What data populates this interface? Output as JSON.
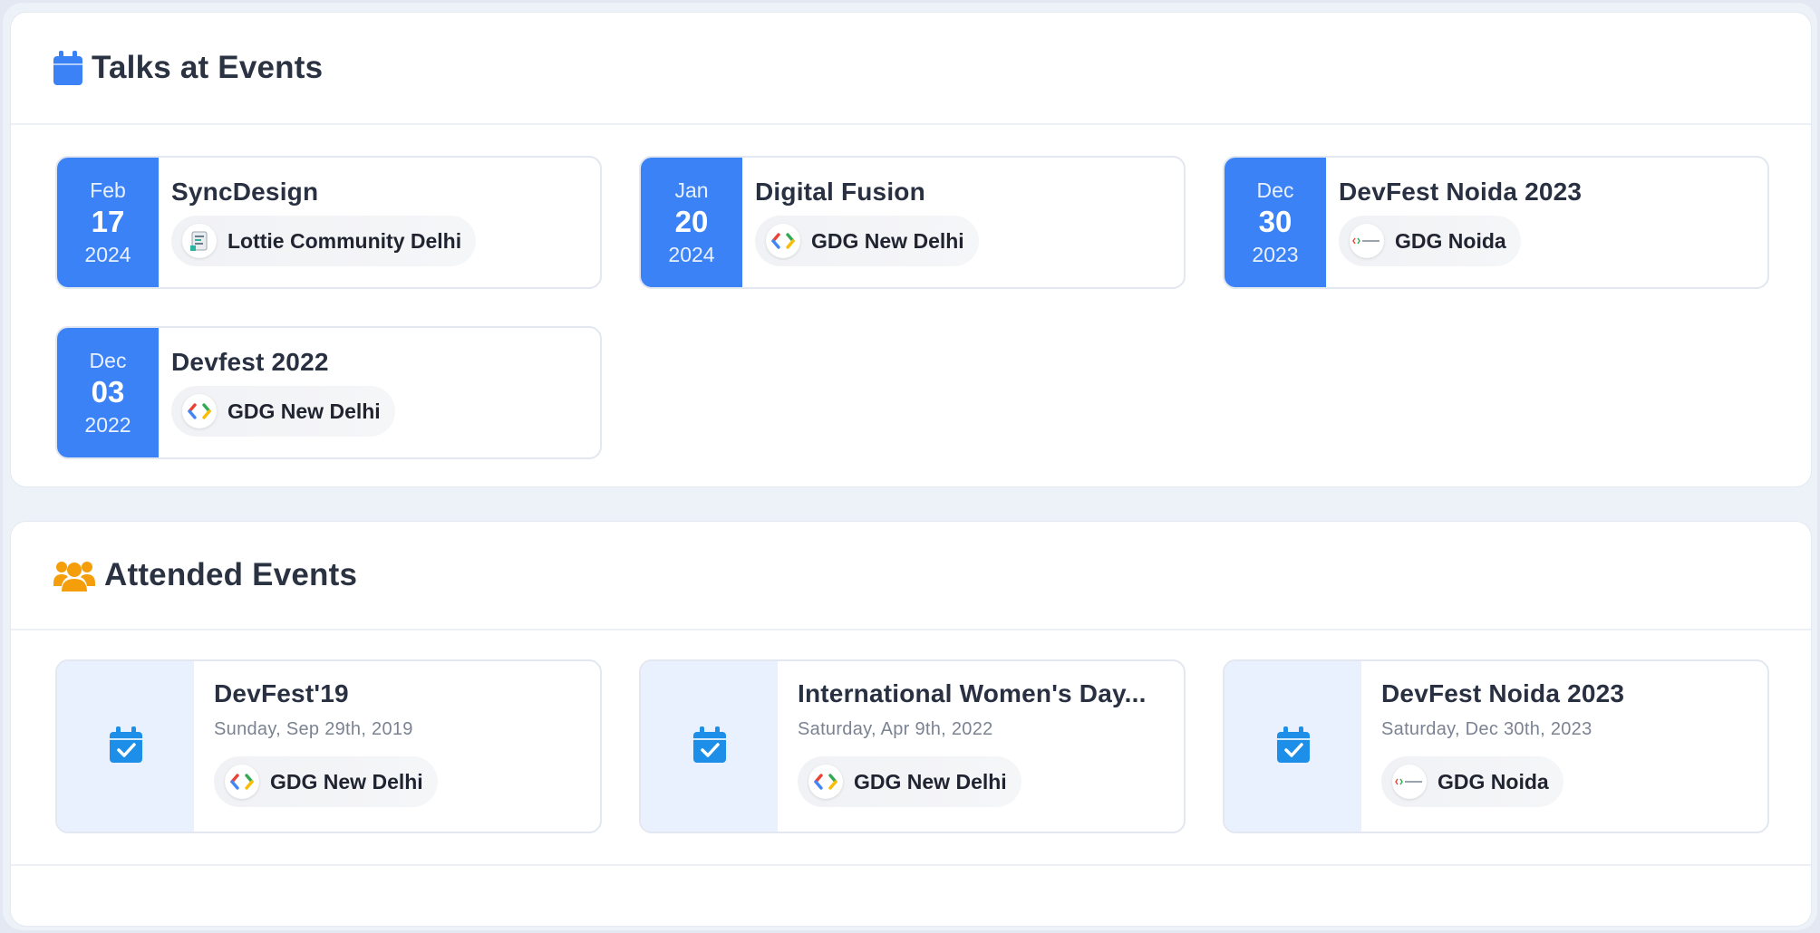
{
  "talks": {
    "title": "Talks at Events",
    "icon": "calendar-icon",
    "accent_color": "#3b82f6",
    "events": [
      {
        "month": "Feb",
        "day": "17",
        "year": "2024",
        "title": "SyncDesign",
        "community": "Lottie Community Delhi",
        "community_logo": "lottie-community-logo-icon"
      },
      {
        "month": "Jan",
        "day": "20",
        "year": "2024",
        "title": "Digital Fusion",
        "community": "GDG New Delhi",
        "community_logo": "gdg-logo-icon"
      },
      {
        "month": "Dec",
        "day": "30",
        "year": "2023",
        "title": "DevFest Noida 2023",
        "community": "GDG Noida",
        "community_logo": "gdg-noida-logo-icon"
      },
      {
        "month": "Dec",
        "day": "03",
        "year": "2022",
        "title": "Devfest 2022",
        "community": "GDG New Delhi",
        "community_logo": "gdg-logo-icon"
      }
    ]
  },
  "attended": {
    "title": "Attended Events",
    "icon": "users-icon",
    "icon_color": "#f59e0b",
    "events": [
      {
        "title": "DevFest'19",
        "date": "Sunday, Sep 29th, 2019",
        "community": "GDG New Delhi",
        "community_logo": "gdg-logo-icon"
      },
      {
        "title": "International Women's Day...",
        "date": "Saturday, Apr 9th, 2022",
        "community": "GDG New Delhi",
        "community_logo": "gdg-logo-icon"
      },
      {
        "title": "DevFest Noida 2023",
        "date": "Saturday, Dec 30th, 2023",
        "community": "GDG Noida",
        "community_logo": "gdg-noida-logo-icon"
      }
    ]
  }
}
